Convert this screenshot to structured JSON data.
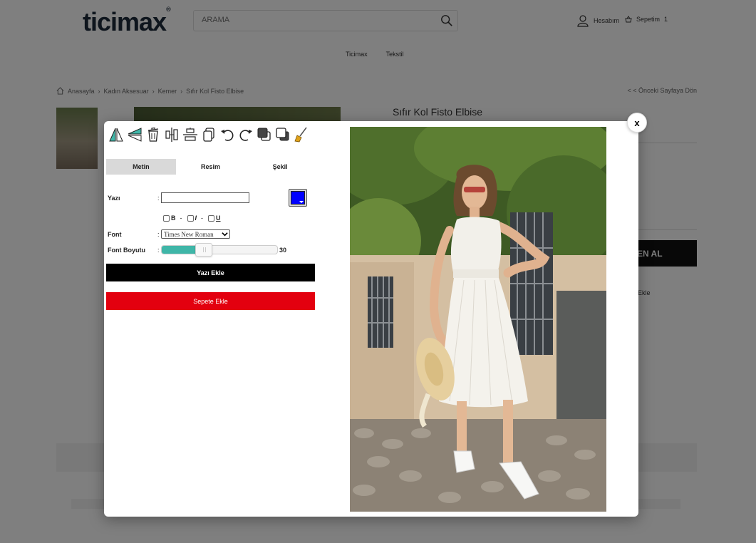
{
  "header": {
    "logo_text": "ticimax",
    "logo_mark": "®",
    "search_placeholder": "ARAMA",
    "account_label": "Hesabım",
    "cart_label": "Sepetim",
    "cart_count": "1"
  },
  "nav": {
    "items": [
      "Ticimax",
      "Tekstil"
    ]
  },
  "breadcrumb": {
    "items": [
      "Anasayfa",
      "Kadın Aksesuar",
      "Kemer",
      "Sıfır Kol Fisto Elbise"
    ],
    "back_label": "< < Önceki Sayfaya Dön"
  },
  "product": {
    "title": "Sıfır Kol Fisto Elbise",
    "buy_label_partial": "EN AL",
    "fav_label_partial": "Ekle"
  },
  "modal": {
    "close_label": "x",
    "tools": [
      "flip-horizontal-icon",
      "flip-vertical-icon",
      "trash-icon",
      "align-center-vertical-icon",
      "align-center-horizontal-icon",
      "copy-icon",
      "undo-icon",
      "redo-icon",
      "bring-front-icon",
      "send-back-icon",
      "clear-brush-icon"
    ],
    "tabs": {
      "text": "Metin",
      "image": "Resim",
      "shape": "Şekil"
    },
    "text_label": "Yazı",
    "text_value": "",
    "colon": ":",
    "text_color": "#0000ff",
    "bold_label": "B",
    "italic_label": "I",
    "underline_label": "U",
    "separator": "-",
    "font_label": "Font",
    "font_value": "Times New Roman",
    "font_size_label": "Font Boyutu",
    "font_size_value": "30",
    "font_size_fraction": 0.36,
    "add_text_label": "Yazı Ekle",
    "add_to_cart_label": "Sepete Ekle"
  },
  "colors": {
    "accent_teal": "#3fb6a8",
    "cart_red": "#e3000f",
    "black": "#000000"
  }
}
